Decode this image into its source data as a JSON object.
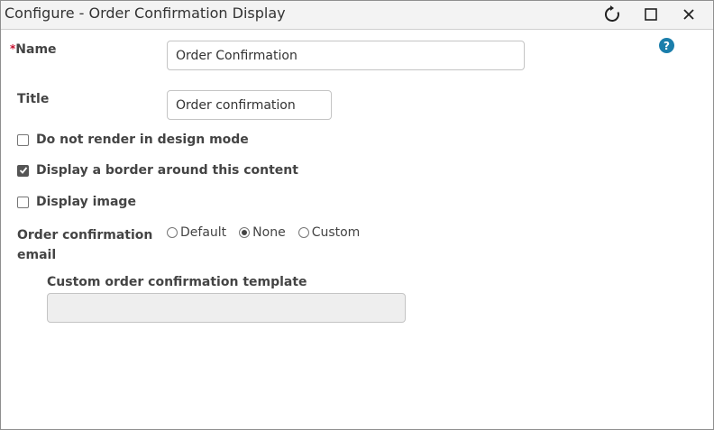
{
  "window": {
    "title": "Configure - Order Confirmation Display",
    "refresh_icon": "refresh-icon",
    "maximize_icon": "maximize-icon",
    "close_icon": "close-icon"
  },
  "help": {
    "icon": "help-icon",
    "glyph": "?"
  },
  "form": {
    "name": {
      "label": "Name",
      "required": true,
      "required_mark": "*",
      "value": "Order Confirmation"
    },
    "title": {
      "label": "Title",
      "value": "Order confirmation"
    },
    "checkboxes": [
      {
        "label": "Do not render in design mode",
        "checked": false
      },
      {
        "label": "Display a border around this content",
        "checked": true
      },
      {
        "label": "Display image",
        "checked": false
      }
    ],
    "order_confirmation_email": {
      "label_line1": "Order confirmation",
      "label_line2": "email",
      "options": [
        "Default",
        "None",
        "Custom"
      ],
      "selected": "None"
    },
    "custom_template": {
      "label": "Custom order confirmation template",
      "value": "",
      "disabled": true
    }
  }
}
